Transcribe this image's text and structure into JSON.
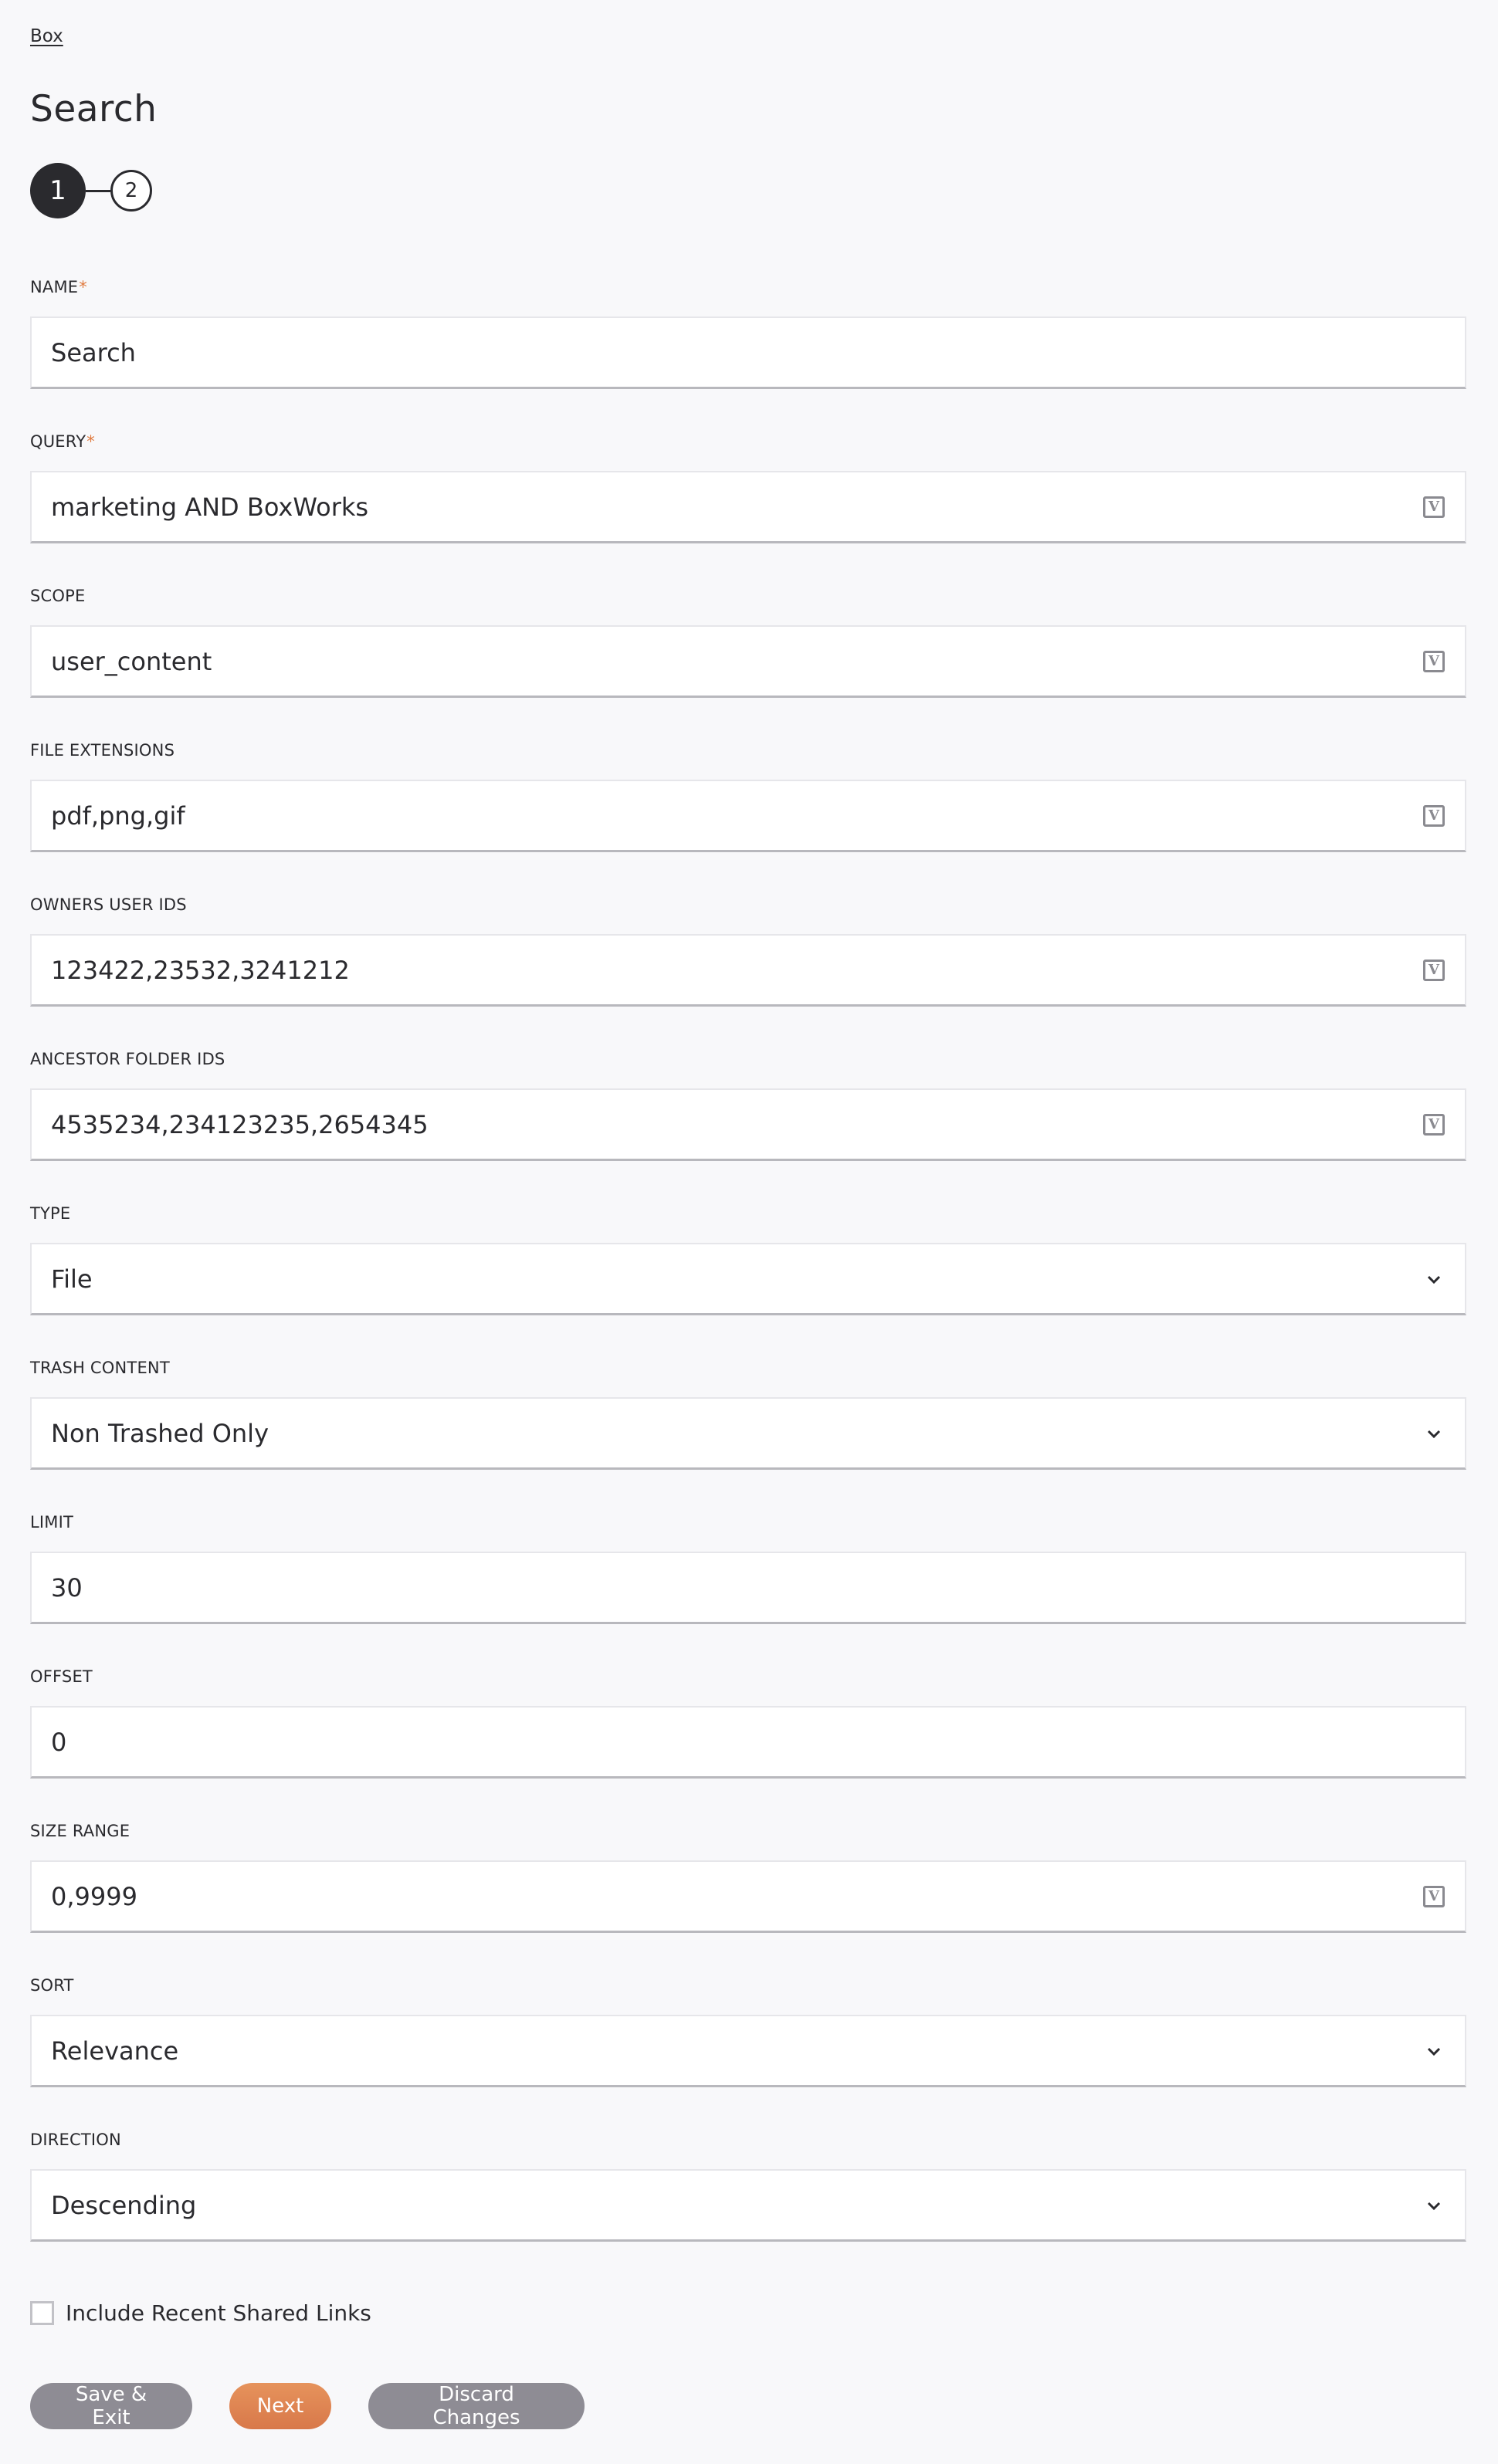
{
  "breadcrumb": "Box",
  "page_title": "Search",
  "stepper": {
    "steps": [
      "1",
      "2"
    ],
    "active_step": 1
  },
  "fields": [
    {
      "label": "NAME",
      "required": true,
      "type": "text",
      "value": "Search",
      "variable_icon": false
    },
    {
      "label": "QUERY",
      "required": true,
      "type": "text",
      "value": "marketing AND BoxWorks",
      "variable_icon": true
    },
    {
      "label": "SCOPE",
      "required": false,
      "type": "text",
      "value": "user_content",
      "variable_icon": true
    },
    {
      "label": "FILE EXTENSIONS",
      "required": false,
      "type": "text",
      "value": "pdf,png,gif",
      "variable_icon": true
    },
    {
      "label": "OWNERS USER IDS",
      "required": false,
      "type": "text",
      "value": "123422,23532,3241212",
      "variable_icon": true
    },
    {
      "label": "ANCESTOR FOLDER IDS",
      "required": false,
      "type": "text",
      "value": "4535234,234123235,2654345",
      "variable_icon": true
    },
    {
      "label": "TYPE",
      "required": false,
      "type": "select",
      "value": "File",
      "variable_icon": false
    },
    {
      "label": "TRASH CONTENT",
      "required": false,
      "type": "select",
      "value": "Non Trashed Only",
      "variable_icon": false
    },
    {
      "label": "LIMIT",
      "required": false,
      "type": "text",
      "value": "30",
      "variable_icon": false
    },
    {
      "label": "OFFSET",
      "required": false,
      "type": "text",
      "value": "0",
      "variable_icon": false
    },
    {
      "label": "SIZE RANGE",
      "required": false,
      "type": "text",
      "value": "0,9999",
      "variable_icon": true
    },
    {
      "label": "SORT",
      "required": false,
      "type": "select",
      "value": "Relevance",
      "variable_icon": false
    },
    {
      "label": "DIRECTION",
      "required": false,
      "type": "select",
      "value": "Descending",
      "variable_icon": false
    }
  ],
  "required_mark": "*",
  "variable_icon_glyph": "V",
  "checkbox": {
    "label": "Include Recent Shared Links",
    "checked": false
  },
  "buttons": {
    "save_exit": "Save & Exit",
    "next": "Next",
    "discard": "Discard Changes"
  },
  "colors": {
    "accent": "#e07a3e",
    "primary_button": "#df8452",
    "secondary_button": "#8e8c94",
    "text": "#2a2a2e",
    "background": "#f8f8fa"
  }
}
